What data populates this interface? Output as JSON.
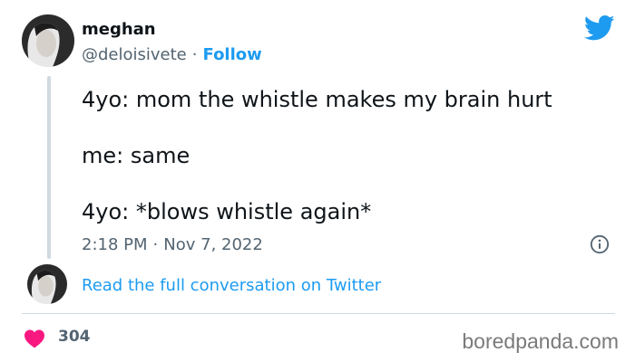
{
  "user": {
    "name": "meghan",
    "handle": "@deloisivete",
    "separator": "·",
    "follow_label": "Follow"
  },
  "tweet": {
    "lines": [
      "4yo: mom the whistle makes my brain hurt",
      "me: same",
      "4yo: *blows whistle again*"
    ],
    "time": "2:18 PM",
    "separator": "·",
    "date": "Nov 7, 2022"
  },
  "footer": {
    "read_full_label": "Read the full conversation on Twitter",
    "likes_count": "304"
  },
  "watermark": "boredpanda.com",
  "colors": {
    "twitter_blue": "#1d9bf0",
    "heart": "#f91880",
    "secondary_text": "#536471"
  },
  "icons": {
    "brand": "twitter-bird-icon",
    "info": "info-icon",
    "like": "heart-icon"
  }
}
